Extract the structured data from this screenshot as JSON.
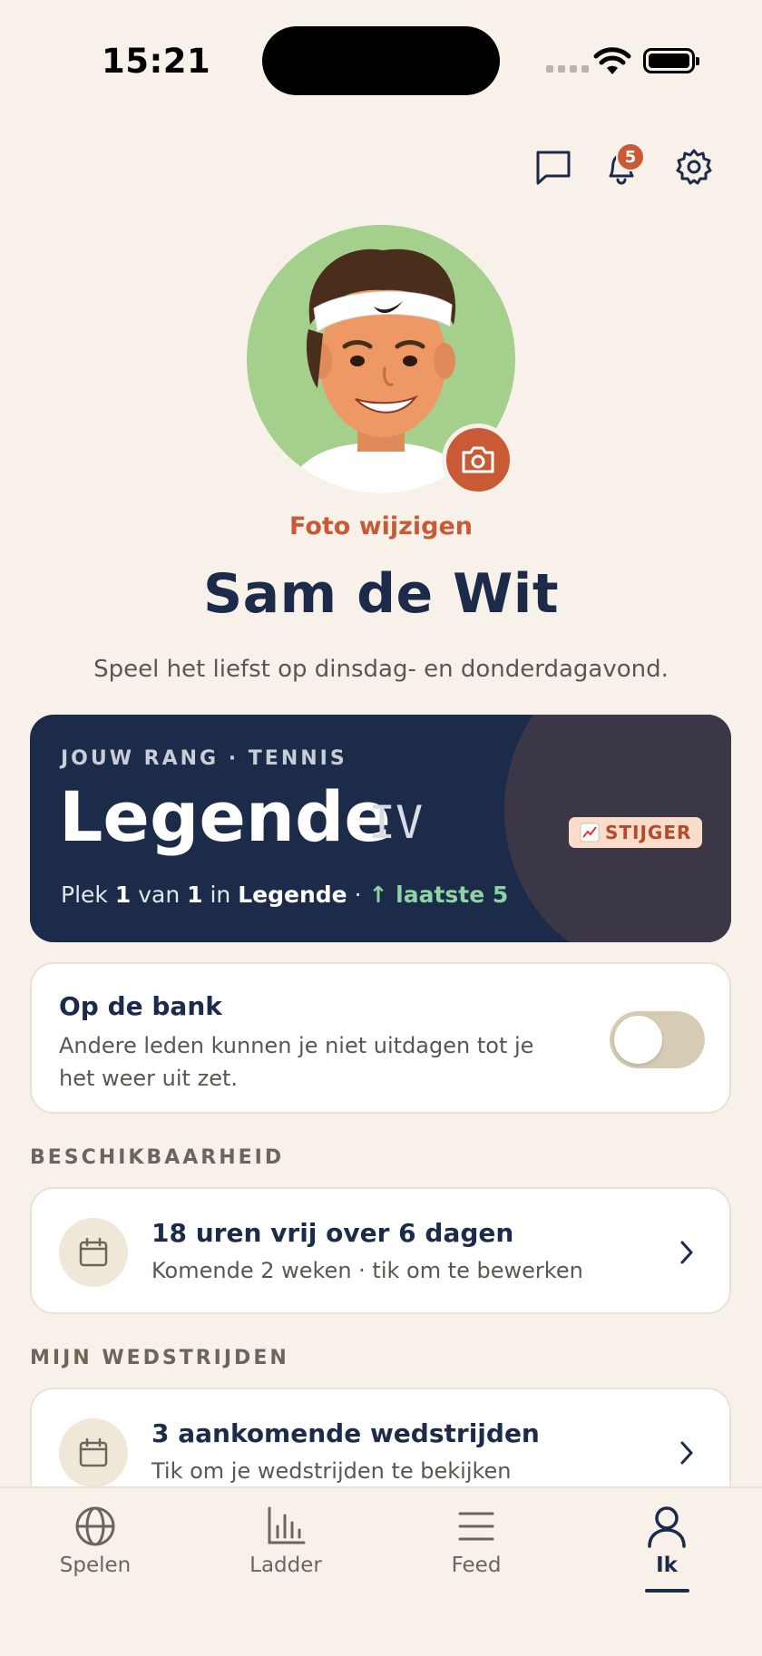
{
  "status_bar": {
    "time": "15:21"
  },
  "header": {
    "notification_count": "5"
  },
  "profile": {
    "change_photo_label": "Foto wijzigen",
    "name": "Sam de Wit",
    "bio": "Speel het liefst op dinsdag- en donderdagavond."
  },
  "rank": {
    "kicker": "JOUW RANG · TENNIS",
    "title": "Legende",
    "level": "IV",
    "trend_badge": "STIJGER",
    "line": {
      "prefix": "Plek",
      "position": "1",
      "of_word": "van",
      "total": "1",
      "in_word": "in",
      "division": "Legende",
      "separator": "·",
      "trend": "↑ laatste 5"
    }
  },
  "bench": {
    "title": "Op de bank",
    "description": "Andere leden kunnen je niet uitdagen tot je het weer uit zet.",
    "enabled": false
  },
  "availability": {
    "section_label": "BESCHIKBAARHEID",
    "title": "18 uren vrij over 6 dagen",
    "subtitle": "Komende 2 weken · tik om te bewerken"
  },
  "matches": {
    "section_label": "MIJN WEDSTRIJDEN",
    "title": "3 aankomende wedstrijden",
    "subtitle": "Tik om je wedstrijden te bekijken"
  },
  "tabs": [
    {
      "label": "Spelen",
      "icon": "globe-icon"
    },
    {
      "label": "Ladder",
      "icon": "bar-chart-icon"
    },
    {
      "label": "Feed",
      "icon": "menu-lines-icon"
    },
    {
      "label": "Ik",
      "icon": "person-icon",
      "active": true
    }
  ],
  "colors": {
    "background": "#f7f1e9",
    "navy": "#1c2b4a",
    "accent": "#c95a36",
    "trend_green": "#8fd3a3"
  }
}
